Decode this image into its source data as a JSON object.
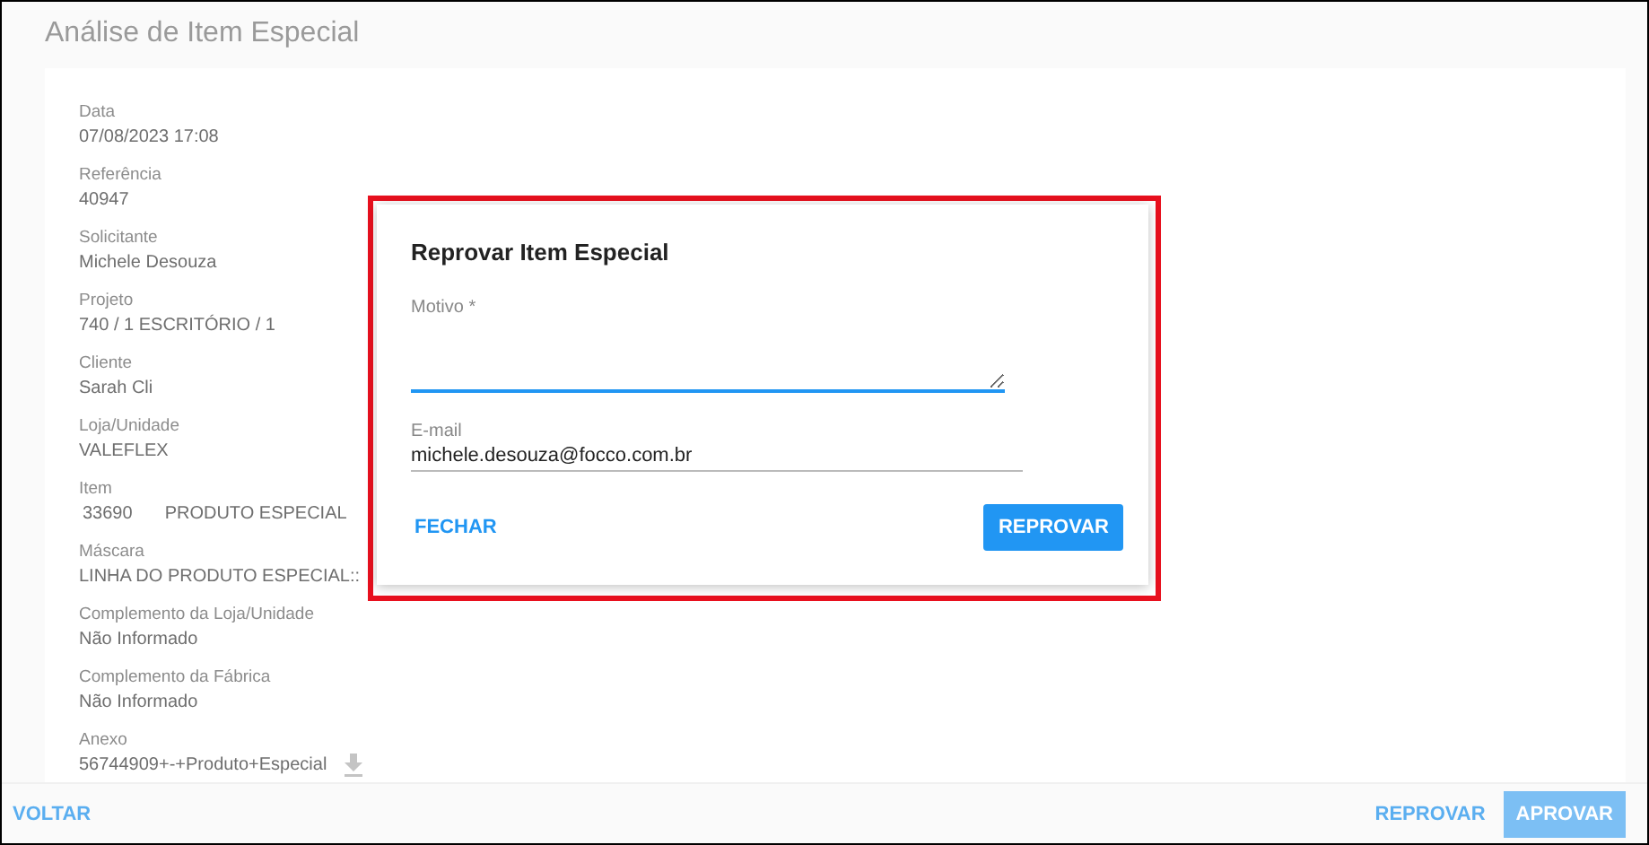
{
  "page": {
    "title": "Análise de Item Especial"
  },
  "fields": [
    {
      "kind": "text",
      "label": "Data",
      "value": "07/08/2023 17:08"
    },
    {
      "kind": "text",
      "label": "Referência",
      "value": "40947"
    },
    {
      "kind": "text",
      "label": "Solicitante",
      "value": "Michele Desouza"
    },
    {
      "kind": "text",
      "label": "Projeto",
      "value": "740 / 1 ESCRITÓRIO / 1"
    },
    {
      "kind": "text",
      "label": "Cliente",
      "value": "Sarah Cli"
    },
    {
      "kind": "text",
      "label": "Loja/Unidade",
      "value": "VALEFLEX"
    },
    {
      "kind": "item",
      "label": "Item",
      "code": "33690",
      "description": "PRODUTO ESPECIAL"
    },
    {
      "kind": "text",
      "label": "Máscara",
      "value": "LINHA DO PRODUTO ESPECIAL::"
    },
    {
      "kind": "text",
      "label": "Complemento da Loja/Unidade",
      "value": "Não Informado"
    },
    {
      "kind": "text",
      "label": "Complemento da Fábrica",
      "value": "Não Informado"
    },
    {
      "kind": "file",
      "label": "Anexo",
      "value": "56744909+-+Produto+Especial"
    }
  ],
  "footer": {
    "back": "VOLTAR",
    "reject": "REPROVAR",
    "approve": "APROVAR"
  },
  "dialog": {
    "title": "Reprovar Item Especial",
    "reason": {
      "label": "Motivo *",
      "focused": true
    },
    "email": {
      "label": "E-mail",
      "value": "michele.desouza@focco.com.br",
      "focused": false
    },
    "close": "FECHAR",
    "confirm": "REPROVAR"
  }
}
